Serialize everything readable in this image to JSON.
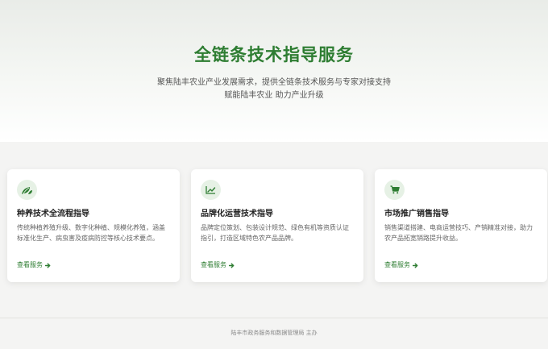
{
  "hero": {
    "title": "全链条技术指导服务",
    "subtitle_line1": "聚焦陆丰农业产业发展需求，提供全链条技术服务与专家对接支持",
    "subtitle_line2": "赋能陆丰农业 助力产业升级"
  },
  "cards": [
    {
      "icon": "leaf-sprout-icon",
      "title": "种养技术全流程指导",
      "desc": "传统种植养殖升级、数字化种植、规模化养殖，涵盖标准化生产、病虫害及疫病防控等核心技术要点。",
      "link": "查看服务"
    },
    {
      "icon": "trend-chart-icon",
      "title": "品牌化运营技术指导",
      "desc": "品牌定位策划、包装设计规范、绿色有机等资质认证指引，打造区域特色农产品品牌。",
      "link": "查看服务"
    },
    {
      "icon": "cart-icon",
      "title": "市场推广销售指导",
      "desc": "销售渠道搭建、电商运营技巧、产销精准对接，助力农产品拓宽销路提升收益。",
      "link": "查看服务"
    }
  ],
  "colors": {
    "accent": "#2e7d32",
    "icon_bg": "#e6f1e5"
  },
  "footer": {
    "text": "陆丰市政务服务和数据管理局 主办"
  }
}
